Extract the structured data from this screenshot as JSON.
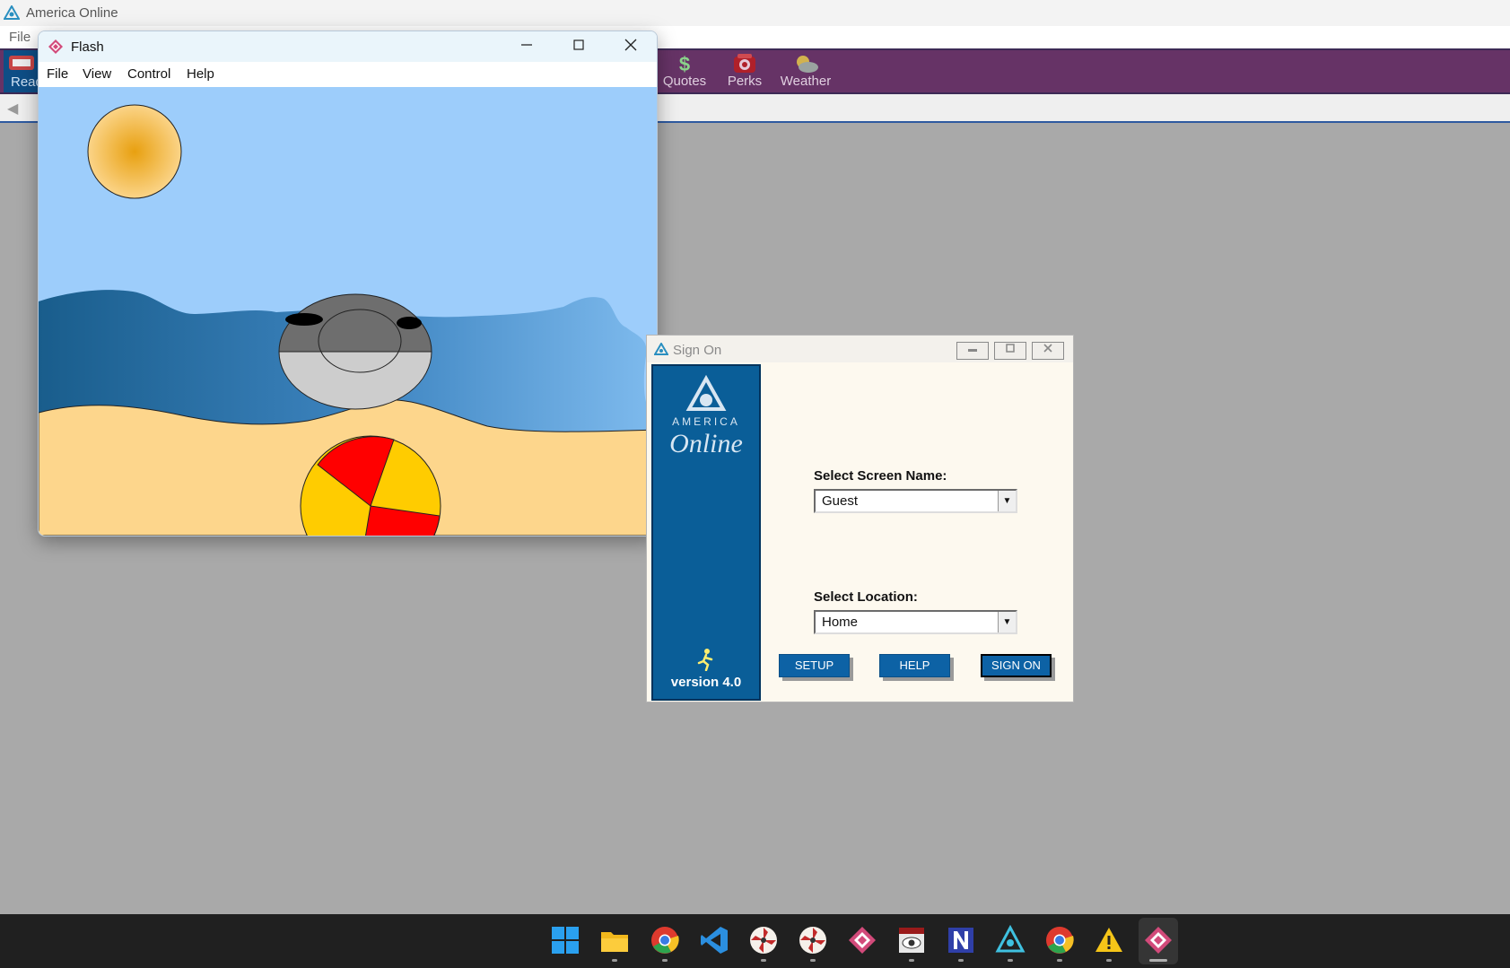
{
  "aol": {
    "window_title": "America  Online",
    "menu": {
      "file": "File"
    },
    "toolbar": {
      "read_partial": "Read",
      "buttons": [
        {
          "label": "Quotes",
          "icon": "dollar-icon"
        },
        {
          "label": "Perks",
          "icon": "perks-icon"
        },
        {
          "label": "Weather",
          "icon": "weather-icon"
        }
      ]
    }
  },
  "flash": {
    "window_title": "Flash",
    "menu": [
      "File",
      "View",
      "Control",
      "Help"
    ],
    "scene": [
      "sun",
      "sky",
      "water",
      "seal",
      "sand",
      "beach-ball"
    ],
    "colors": {
      "sky": "#9dcdfb",
      "sand": "#fdd68c",
      "ball_red": "#ff0000",
      "ball_yellow": "#ffcc00"
    }
  },
  "signon": {
    "title": "Sign On",
    "logo_line1": "AMERICA",
    "logo_line2": "Online",
    "version": "version 4.0",
    "screen_name_label": "Select Screen Name:",
    "screen_name_value": "Guest",
    "location_label": "Select Location:",
    "location_value": "Home",
    "buttons": {
      "setup": "SETUP",
      "help": "HELP",
      "sign_on": "SIGN ON"
    }
  },
  "taskbar": {
    "apps": [
      "windows-start-icon",
      "file-explorer-icon",
      "chrome-icon",
      "vscode-icon",
      "pinwheel-app-icon",
      "pinwheel-app-icon-2",
      "flash-icon",
      "eye-app-icon",
      "n-app-icon",
      "aol-icon",
      "chrome-icon-2",
      "warning-icon",
      "flash-active-icon"
    ]
  }
}
